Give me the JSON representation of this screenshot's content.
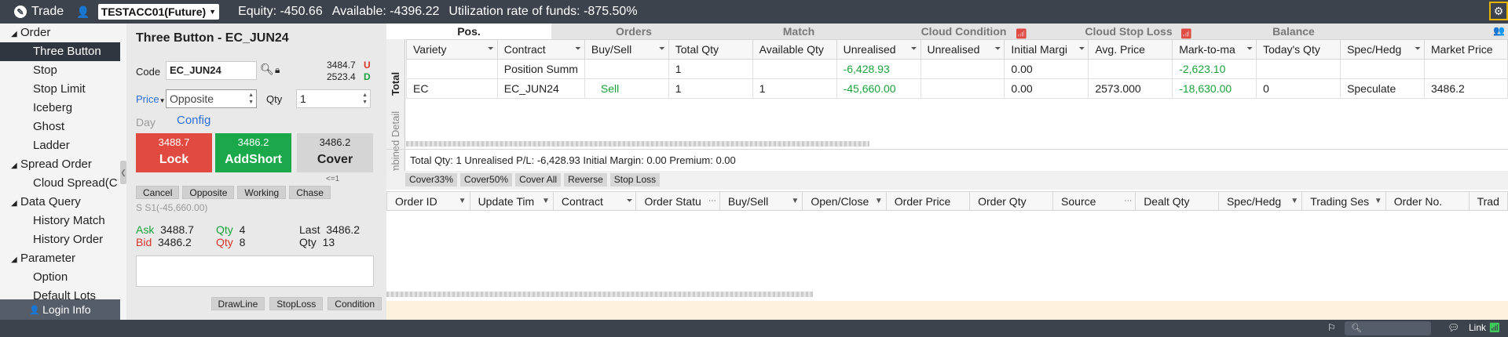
{
  "topbar": {
    "app": "Trade",
    "account": "TESTACC01(Future)",
    "equity": "Equity: -450.66",
    "available": "Available: -4396.22",
    "utilization": "Utilization rate of funds: -875.50%"
  },
  "sidebar": {
    "groups": [
      {
        "label": "Order",
        "items": [
          "Three Button",
          "Stop",
          "Stop Limit",
          "Iceberg",
          "Ghost",
          "Ladder"
        ]
      },
      {
        "label": "Spread Order",
        "items": [
          "Cloud Spread(C"
        ]
      },
      {
        "label": "Data Query",
        "items": [
          "History Match",
          "History Order"
        ]
      },
      {
        "label": "Parameter",
        "items": [
          "Option",
          "Default Lots"
        ]
      }
    ],
    "active": "Three Button",
    "login": "Login Info"
  },
  "order_panel": {
    "title": "Three Button - EC_JUN24",
    "code_label": "Code",
    "code_value": "EC_JUN24",
    "price_up": "3484.7",
    "price_down": "2523.4",
    "up_flag": "U",
    "down_flag": "D",
    "price_label": "Price",
    "price_value": "Opposite",
    "qty_label": "Qty",
    "qty_value": "1",
    "day_label": "Day",
    "config_label": "Config",
    "lock_price": "3488.7",
    "lock_label": "Lock",
    "add_price": "3486.2",
    "add_label": "AddShort",
    "cover_price": "3486.2",
    "cover_label": "Cover",
    "cover_note": "<=1",
    "small_buttons": [
      "Cancel",
      "Opposite",
      "Working",
      "Chase"
    ],
    "position_line": "S   S1(-45,660.00)",
    "ask_label": "Ask",
    "ask_price": "3488.7",
    "ask_qty_label": "Qty",
    "ask_qty": "4",
    "bid_label": "Bid",
    "bid_price": "3486.2",
    "bid_qty_label": "Qty",
    "bid_qty": "8",
    "last_label": "Last",
    "last_price": "3486.2",
    "last_qty_label": "Qty",
    "last_qty": "13",
    "bottom_buttons": [
      "DrawLine",
      "StopLoss",
      "Condition"
    ]
  },
  "tabs": [
    "Pos.",
    "Orders",
    "Match",
    "Cloud Condition",
    "Cloud Stop Loss",
    "Balance"
  ],
  "vertical_tabs": [
    "Total",
    "Combined Detail"
  ],
  "positions": {
    "columns": [
      "Variety",
      "Contract",
      "Buy/Sell",
      "Total Qty",
      "Available Qty",
      "Unrealised",
      "Unrealised",
      "Initial Margi",
      "Avg. Price",
      "Mark-to-ma",
      "Today's Qty",
      "Spec/Hedg",
      "Market Price"
    ],
    "rows": [
      [
        "",
        "Position Summ",
        "",
        "1",
        "",
        "-6,428.93",
        "",
        "0.00",
        "",
        "-2,623.10",
        "",
        "",
        ""
      ],
      [
        "EC",
        "EC_JUN24",
        "Sell",
        "1",
        "1",
        "-45,660.00",
        "",
        "0.00",
        "2573.000",
        "-18,630.00",
        "0",
        "Speculate",
        "3486.2"
      ]
    ],
    "summary": "Total Qty: 1   Unrealised P/L: -6,428.93   Initial Margin: 0.00   Premium: 0.00"
  },
  "actions": [
    "Cover33%",
    "Cover50%",
    "Cover All",
    "Reverse",
    "Stop Loss"
  ],
  "orders": {
    "columns": [
      "Order ID",
      "Update Tim",
      "Contract",
      "Order Statu",
      "Buy/Sell",
      "Open/Close",
      "Order Price",
      "Order Qty",
      "Source",
      "Dealt Qty",
      "Spec/Hedg",
      "Trading Ses",
      "Order No.",
      "Trad"
    ]
  },
  "footer": {
    "search_placeholder": "",
    "link_label": "Link"
  },
  "colors": {
    "topbar": "#3d434d",
    "lock": "#e04a41",
    "addshort": "#1aa84b",
    "negative": "#1aa33a",
    "sell": "#1aa33a",
    "highlight": "#e8b400"
  }
}
